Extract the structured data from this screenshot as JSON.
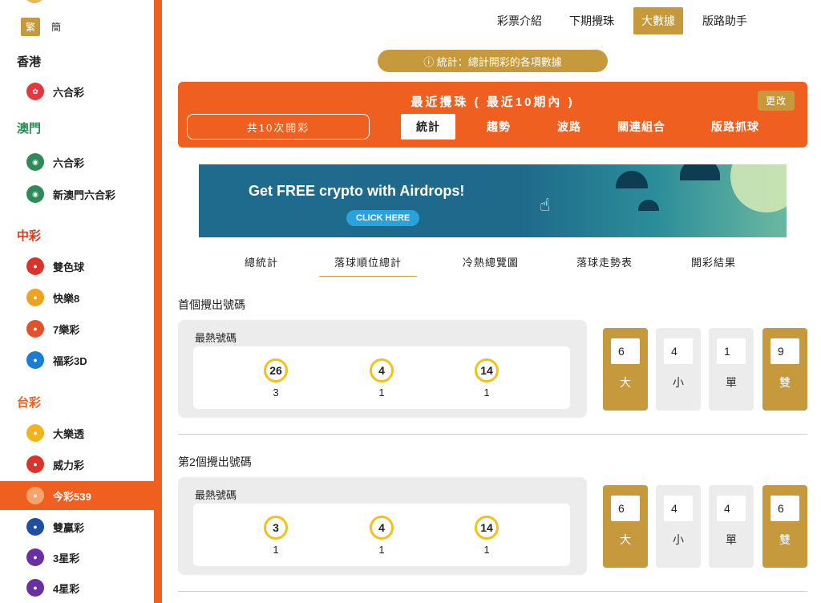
{
  "sidebar": {
    "lang": {
      "trad": "繁",
      "simp": "簡"
    },
    "regions": {
      "hk": "香港",
      "macau": "澳門",
      "china": "中彩",
      "taiwan": "台彩"
    },
    "items": [
      {
        "label": "六合彩",
        "icon": "hk-lottery-icon",
        "color": "#e03a3e"
      },
      {
        "label": "六合彩",
        "icon": "macau-lottery-icon",
        "color": "#2e8b57"
      },
      {
        "label": "新澳門六合彩",
        "icon": "new-macau-lottery-icon",
        "color": "#2e8b57"
      },
      {
        "label": "雙色球",
        "icon": "double-color-ball-icon",
        "color": "#d9342b"
      },
      {
        "label": "快樂8",
        "icon": "happy8-icon",
        "color": "#f0a21f"
      },
      {
        "label": "7樂彩",
        "icon": "7-lottery-icon",
        "color": "#e2512b"
      },
      {
        "label": "福彩3D",
        "icon": "fucai3d-icon",
        "color": "#1a7dd1"
      },
      {
        "label": "大樂透",
        "icon": "lotto-icon",
        "color": "#f0b51e"
      },
      {
        "label": "威力彩",
        "icon": "power-lottery-icon",
        "color": "#d9342b"
      },
      {
        "label": "今彩539",
        "icon": "daily539-icon",
        "color": "#ef5f1f"
      },
      {
        "label": "雙贏彩",
        "icon": "twin-win-icon",
        "color": "#1f4fa0"
      },
      {
        "label": "3星彩",
        "icon": "3star-icon",
        "color": "#6a2fa0"
      },
      {
        "label": "4星彩",
        "icon": "4star-icon",
        "color": "#6a2fa0"
      }
    ]
  },
  "topnav": [
    "彩票介紹",
    "下期攪珠",
    "大數據",
    "版路助手"
  ],
  "info_pill": "ⓘ 統計：總計開彩的各項數據",
  "panel": {
    "title": "最近攪珠 ( 最近10期內 )",
    "change": "更改",
    "count": "共10次開彩",
    "tabs": [
      "統計",
      "趨勢",
      "波路",
      "關連組合",
      "版路抓球"
    ]
  },
  "ad": {
    "headline": "Get FREE crypto with Airdrops!",
    "button": "CLICK HERE"
  },
  "subtabs": [
    "總統計",
    "落球順位總計",
    "冷熱總覽圖",
    "落球走勢表",
    "開彩結果"
  ],
  "sections": [
    {
      "title": "首個攪出號碼",
      "label": "最熱號碼",
      "balls": [
        {
          "n": "26",
          "c": "3"
        },
        {
          "n": "4",
          "c": "1"
        },
        {
          "n": "14",
          "c": "1"
        }
      ],
      "stats": [
        {
          "v": "6",
          "l": "大"
        },
        {
          "v": "4",
          "l": "小"
        },
        {
          "v": "1",
          "l": "單"
        },
        {
          "v": "9",
          "l": "雙"
        }
      ]
    },
    {
      "title": "第2個攪出號碼",
      "label": "最熱號碼",
      "balls": [
        {
          "n": "3",
          "c": "1"
        },
        {
          "n": "4",
          "c": "1"
        },
        {
          "n": "14",
          "c": "1"
        }
      ],
      "stats": [
        {
          "v": "6",
          "l": "大"
        },
        {
          "v": "4",
          "l": "小"
        },
        {
          "v": "4",
          "l": "單"
        },
        {
          "v": "6",
          "l": "雙"
        }
      ]
    }
  ]
}
